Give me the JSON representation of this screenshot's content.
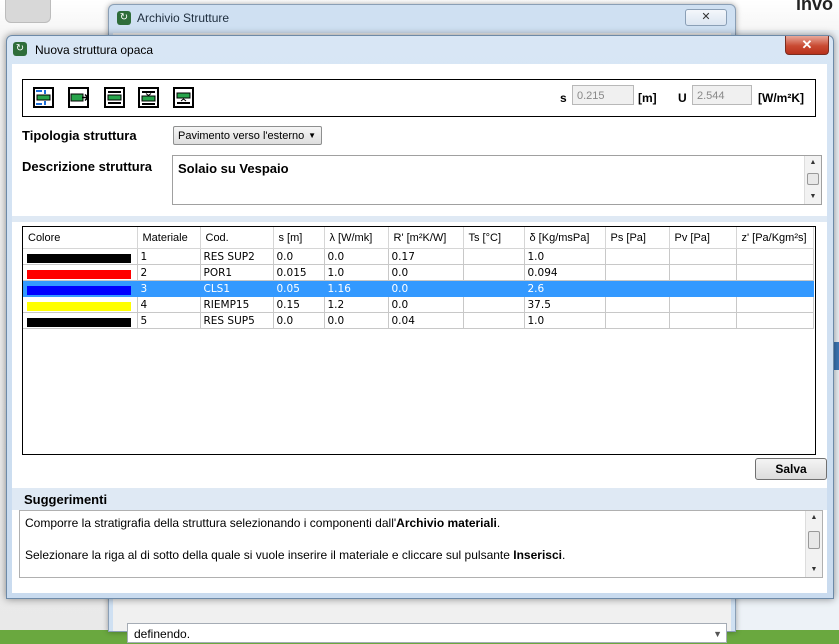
{
  "background": {
    "app_name_partial": "invo",
    "archivio_window": {
      "title": "Archivio Strutture",
      "close_glyph": "✕",
      "combo_value": "definendo.",
      "combo_arrow": "▼"
    }
  },
  "dialog": {
    "title": "Nuova struttura opaca",
    "close_glyph": "✕",
    "app_icon": "app-icon"
  },
  "toolbar": {
    "buttons": [
      "insert-layer-icon",
      "append-layer-icon",
      "layer-edit-icon",
      "layer-move-icon",
      "layer-remove-icon"
    ],
    "s_label": "s",
    "s_value": "0.215",
    "s_unit": "[m]",
    "u_label": "U",
    "u_value": "2.544",
    "u_unit": "[W/m²K]"
  },
  "form": {
    "tipologia_label": "Tipologia struttura",
    "tipologia_value": "Pavimento verso l'esterno",
    "tipologia_arrow": "▼",
    "descrizione_label": "Descrizione struttura",
    "descrizione_value": "Solaio su Vespaio"
  },
  "table": {
    "columns": [
      "Colore",
      "Materiale",
      "Cod.",
      "s [m]",
      "λ [W/mk]",
      "R' [m²K/W]",
      "Ts [°C]",
      "δ [Kg/msPa]",
      "Ps [Pa]",
      "Pv [Pa]",
      "z' [Pa/Kgm²s]"
    ],
    "rows": [
      {
        "color": "#000000",
        "materiale": "1",
        "cod": "RES SUP2",
        "s": "0.0",
        "lambda": "0.0",
        "r": "0.17",
        "ts": "",
        "delta": "1.0",
        "ps": "",
        "pv": "",
        "z": ""
      },
      {
        "color": "#ff0000",
        "materiale": "2",
        "cod": "POR1",
        "s": "0.015",
        "lambda": "1.0",
        "r": "0.0",
        "ts": "",
        "delta": "0.094",
        "ps": "",
        "pv": "",
        "z": ""
      },
      {
        "color": "#0000ff",
        "materiale": "3",
        "cod": "CLS1",
        "s": "0.05",
        "lambda": "1.16",
        "r": "0.0",
        "ts": "",
        "delta": "2.6",
        "ps": "",
        "pv": "",
        "z": ""
      },
      {
        "color": "#ffff00",
        "materiale": "4",
        "cod": "RIEMP15",
        "s": "0.15",
        "lambda": "1.2",
        "r": "0.0",
        "ts": "",
        "delta": "37.5",
        "ps": "",
        "pv": "",
        "z": ""
      },
      {
        "color": "#000000",
        "materiale": "5",
        "cod": "RES SUP5",
        "s": "0.0",
        "lambda": "0.0",
        "r": "0.04",
        "ts": "",
        "delta": "1.0",
        "ps": "",
        "pv": "",
        "z": ""
      }
    ],
    "selected_row": 2
  },
  "save_label": "Salva",
  "suggerimenti": {
    "title": "Suggerimenti",
    "line1_pre": "Comporre la stratigrafia della struttura selezionando i componenti dall'",
    "line1_bold": "Archivio materiali",
    "line1_post": ".",
    "line2_pre": "Selezionare la riga al di sotto della quale si vuole inserire il materiale e cliccare sul pulsante ",
    "line2_bold": "Inserisci",
    "line2_post": "."
  },
  "scroll": {
    "up": "▲",
    "down": "▼"
  }
}
